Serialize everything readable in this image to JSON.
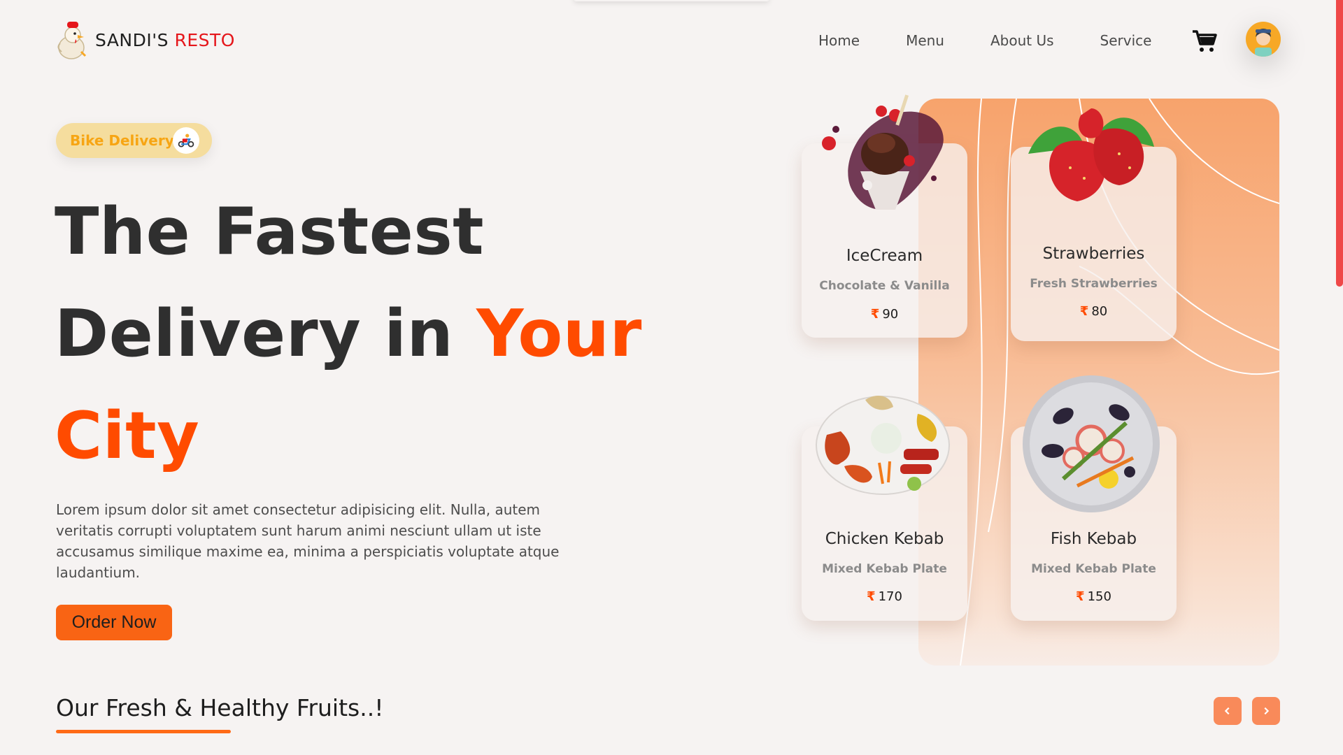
{
  "brand": {
    "name_part1": "SANDI'S",
    "name_part2": "RESTO"
  },
  "nav": {
    "items": [
      "Home",
      "Menu",
      "About Us",
      "Service"
    ]
  },
  "hero": {
    "badge": "Bike Delivery",
    "headline_line1": "The Fastest",
    "headline_line2a": "Delivery in",
    "headline_line2b": "Your",
    "headline_line3": "City",
    "description": "Lorem ipsum dolor sit amet consectetur adipisicing elit. Nulla, autem veritatis corrupti voluptatem sunt harum animi nesciunt ullam ut iste accusamus similique maxime ea, minima a perspiciatis voluptate atque laudantium.",
    "cta": "Order Now"
  },
  "cards": [
    {
      "name": "IceCream",
      "sub": "Chocolate & Vanilla",
      "currency": "₹",
      "price": "90"
    },
    {
      "name": "Strawberries",
      "sub": "Fresh Strawberries",
      "currency": "₹",
      "price": "80"
    },
    {
      "name": "Chicken Kebab",
      "sub": "Mixed Kebab Plate",
      "currency": "₹",
      "price": "170"
    },
    {
      "name": "Fish Kebab",
      "sub": "Mixed Kebab Plate",
      "currency": "₹",
      "price": "150"
    }
  ],
  "section": {
    "title": "Our Fresh & Healthy Fruits..!"
  },
  "colors": {
    "accent": "#ff4b00",
    "button": "#f96414",
    "badge_bg": "#f5dd9e",
    "badge_text": "#f7a513",
    "panel_top": "#f7a36c",
    "arrow_bg": "#f98a5a"
  },
  "icons": {
    "logo": "chicken-chef-logo-icon",
    "cart": "cart-icon",
    "avatar": "user-avatar-icon",
    "badge": "scooter-icon",
    "prev": "chevron-left-icon",
    "next": "chevron-right-icon"
  }
}
